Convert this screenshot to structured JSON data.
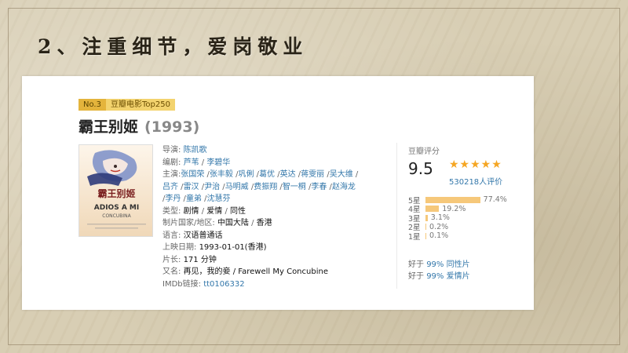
{
  "slide": {
    "title": "2、注重细节，爱岗敬业"
  },
  "movie": {
    "rank": "No.3",
    "rank_list": "豆瓣电影Top250",
    "title": "霸王别姬",
    "year": "(1993)"
  },
  "poster": {
    "cn_title": "霸王别姬",
    "en_title": "ADIOS A MI",
    "en_title_2": "CONCUBINA"
  },
  "info": {
    "director_label": "导演:",
    "director": "陈凯歌",
    "writer_label": "编剧:",
    "writers": [
      "芦苇",
      "李碧华"
    ],
    "cast_label": "主演:",
    "cast": [
      "张国荣",
      "张丰毅",
      "巩俐",
      "葛优",
      "英达",
      "蒋雯丽",
      "吴大维",
      "吕齐",
      "雷汉",
      "尹治",
      "马明威",
      "费振翔",
      "智一桐",
      "李春",
      "赵海龙",
      "李丹",
      "童弟",
      "沈慧芬"
    ],
    "genre_label": "类型:",
    "genres": [
      "剧情",
      "爱情",
      "同性"
    ],
    "country_label": "制片国家/地区:",
    "countries": [
      "中国大陆",
      "香港"
    ],
    "language_label": "语言:",
    "language": "汉语普通话",
    "release_label": "上映日期:",
    "release": "1993-01-01(香港)",
    "runtime_label": "片长:",
    "runtime": "171 分钟",
    "aka_label": "又名:",
    "aka": "再见，我的妾 / Farewell My Concubine",
    "imdb_label": "IMDb链接:",
    "imdb": "tt0106332"
  },
  "rating": {
    "label": "豆瓣评分",
    "score": "9.5",
    "stars": "★★★★★",
    "count": "530218人评价",
    "distribution": [
      {
        "star": "5星",
        "pct": "77.4%",
        "value": 77.4
      },
      {
        "star": "4星",
        "pct": "19.2%",
        "value": 19.2
      },
      {
        "star": "3星",
        "pct": "3.1%",
        "value": 3.1
      },
      {
        "star": "2星",
        "pct": "0.2%",
        "value": 0.2
      },
      {
        "star": "1星",
        "pct": "0.1%",
        "value": 0.1
      }
    ],
    "better_than": [
      {
        "prefix": "好于",
        "pct": "99%",
        "genre": "同性片"
      },
      {
        "prefix": "好于",
        "pct": "99%",
        "genre": "爱情片"
      }
    ]
  },
  "colors": {
    "link": "#3377aa",
    "star": "#f5a623",
    "bar": "#f6c87a",
    "badge": "#e4b43c"
  }
}
